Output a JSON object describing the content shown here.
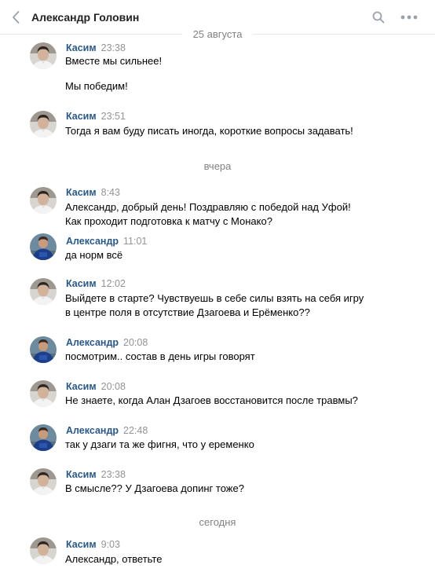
{
  "header": {
    "title": "Александр Головин"
  },
  "dates": {
    "d1": "25 августа",
    "d2": "вчера",
    "d3": "сегодня"
  },
  "messages": [
    {
      "name": "Касим",
      "time": "23:38",
      "lines": [
        "Вместе мы сильнее!",
        "Мы победим!"
      ]
    },
    {
      "name": "Касим",
      "time": "23:51",
      "lines": [
        "Тогда я вам буду писать иногда, короткие вопросы задавать!"
      ]
    },
    {
      "name": "Касим",
      "time": "8:43",
      "lines": [
        "Александр, добрый день! Поздравляю с победой над Уфой!",
        "Как проходит подготовка к матчу с Монако?"
      ]
    },
    {
      "name": "Александр",
      "time": "11:01",
      "lines": [
        "да норм всё"
      ]
    },
    {
      "name": "Касим",
      "time": "12:02",
      "lines": [
        "Выйдете в старте? Чувствуешь в себе силы взять на себя игру",
        "в центре поля в отсутствие Дзагоева и Ерёменко??"
      ]
    },
    {
      "name": "Александр",
      "time": "20:08",
      "lines": [
        "посмотрим.. состав в день игры говорят"
      ]
    },
    {
      "name": "Касим",
      "time": "20:08",
      "lines": [
        "Не знаете, когда Алан Дзагоев восстановится после травмы?"
      ]
    },
    {
      "name": "Александр",
      "time": "22:48",
      "lines": [
        "так у дзаги та же фигня, что у еременко"
      ]
    },
    {
      "name": "Касим",
      "time": "23:38",
      "lines": [
        "В смысле?? У Дзагоева допинг тоже?"
      ]
    },
    {
      "name": "Касим",
      "time": "9:03",
      "lines": [
        "Александр, ответьте"
      ]
    }
  ],
  "colors": {
    "name": "#2a5885",
    "time": "#939393",
    "separator": "#828282"
  },
  "icons": {
    "back": "chevron-left-icon",
    "search": "search-icon",
    "more": "more-icon"
  }
}
